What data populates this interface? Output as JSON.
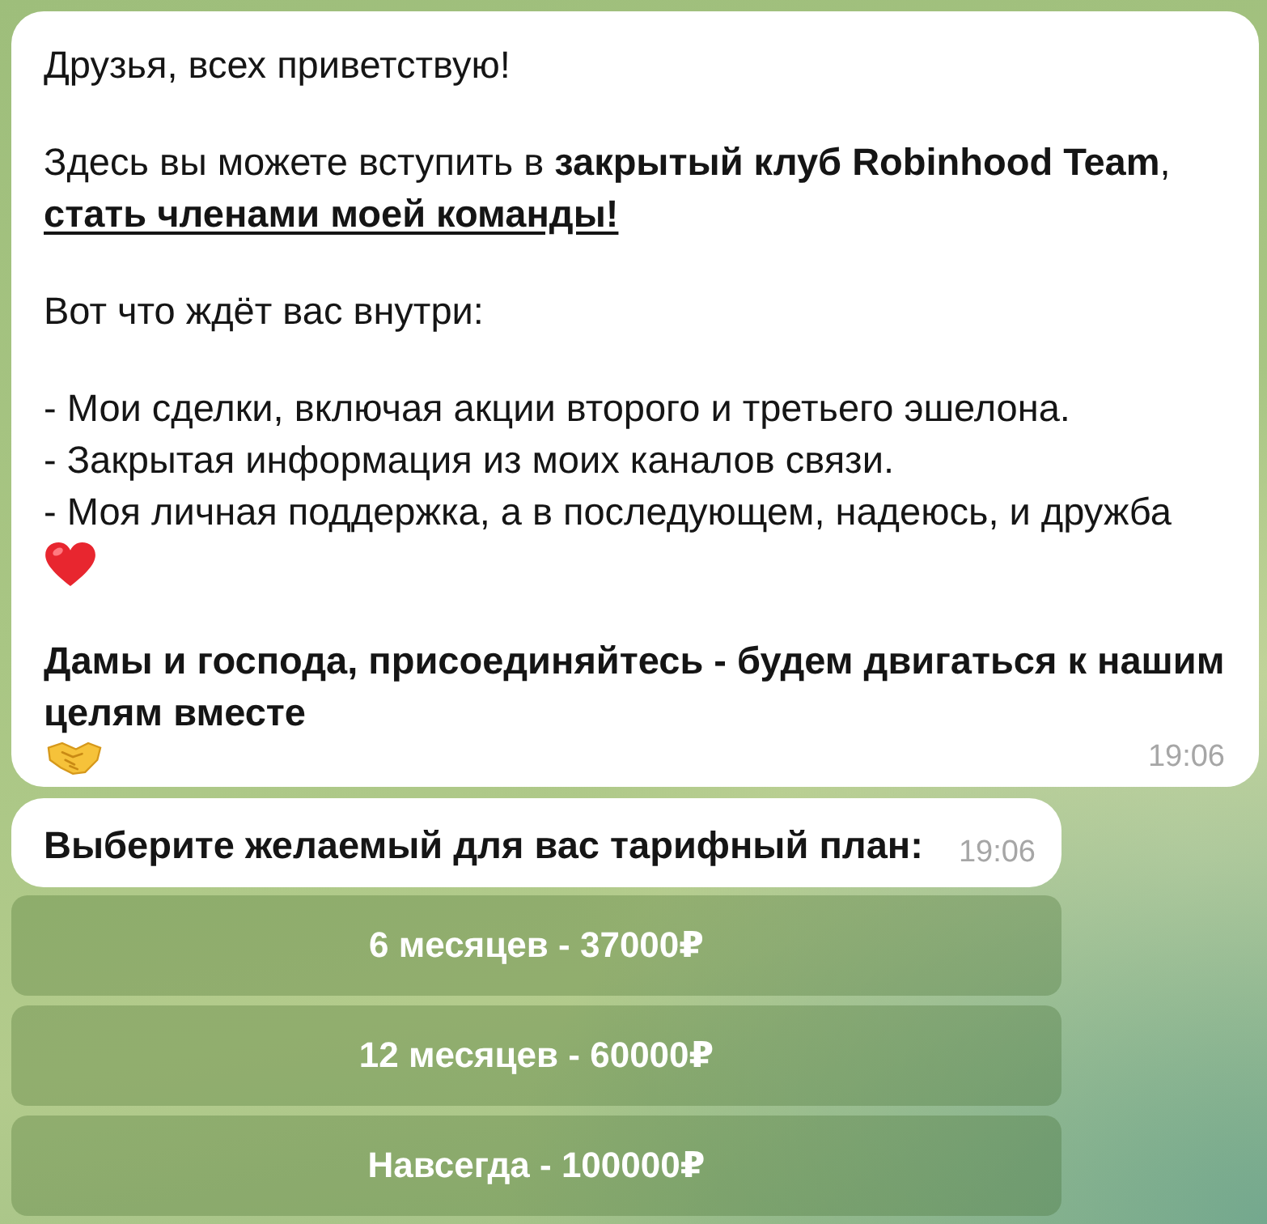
{
  "messages": [
    {
      "kind": "post",
      "paragraphs": [
        {
          "kind": "plain",
          "text": "Друзья, всех приветствую!"
        },
        {
          "kind": "plain",
          "text": "Здесь вы можете вступить в **закрытый клуб Robinhood Team**,",
          "underlined": "стать членами моей команды!"
        },
        {
          "kind": "plain",
          "text": "Вот что ждёт вас внутри:"
        },
        {
          "kind": "list",
          "items": [
            "- Мои сделки, включая акции второго и третьего эшелона.",
            "- Закрытая информация из моих каналов связи.",
            "- Моя личная поддержка, а в последующем, надеюсь, и дружба"
          ]
        },
        {
          "kind": "closing",
          "text": "Дамы и господа, присоединяйтесь - будем двигаться к нашим целям вместе"
        }
      ],
      "time": "19:06"
    },
    {
      "kind": "prompt",
      "paragraphs": [
        {
          "kind": "bold",
          "text": "Выберите желаемый для вас тарифный план:"
        }
      ],
      "time": "19:06",
      "keyboard": [
        "6 месяцев - 37000₽",
        "12 месяцев - 60000₽",
        "Навсегда - 100000₽"
      ]
    }
  ]
}
